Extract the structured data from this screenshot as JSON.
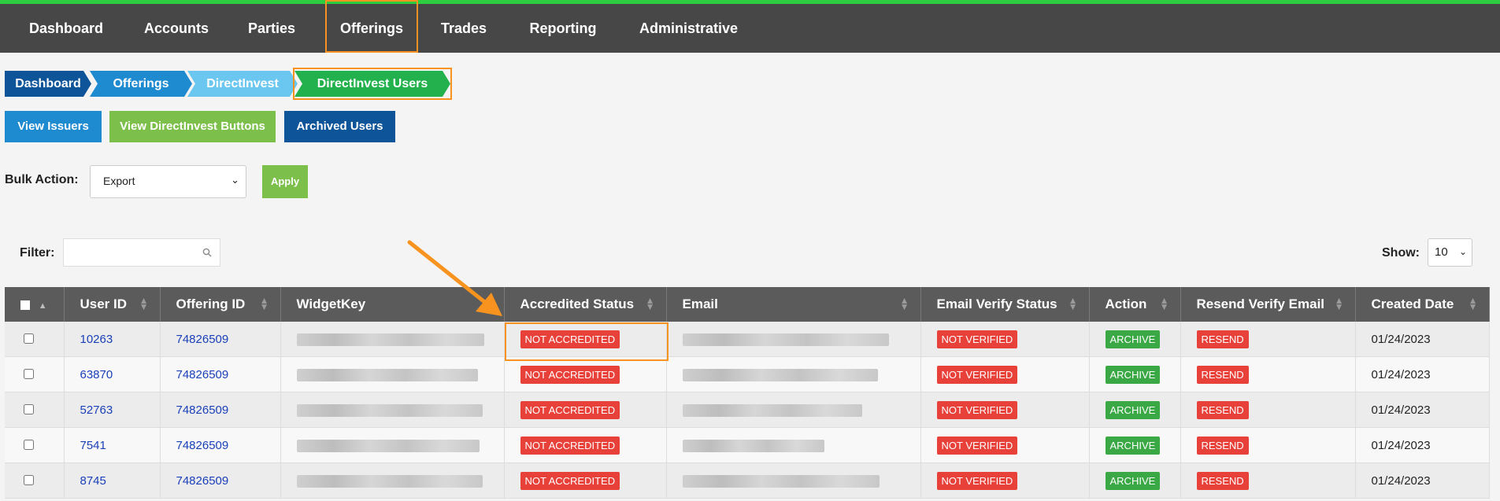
{
  "nav": {
    "items": [
      "Dashboard",
      "Accounts",
      "Parties",
      "Offerings",
      "Trades",
      "Reporting",
      "Administrative"
    ],
    "active": "Offerings"
  },
  "breadcrumb": [
    "Dashboard",
    "Offerings",
    "DirectInvest",
    "DirectInvest Users"
  ],
  "buttons": {
    "view_issuers": "View Issuers",
    "view_directinvest_buttons": "View DirectInvest Buttons",
    "archived_users": "Archived Users",
    "apply": "Apply"
  },
  "bulk_action": {
    "label": "Bulk Action:",
    "selected": "Export"
  },
  "filter": {
    "label": "Filter:",
    "value": ""
  },
  "show": {
    "label": "Show:",
    "selected": "10"
  },
  "table": {
    "columns": [
      "User ID",
      "Offering ID",
      "WidgetKey",
      "Accredited Status",
      "Email",
      "Email Verify Status",
      "Action",
      "Resend Verify Email",
      "Created Date"
    ],
    "rows": [
      {
        "user_id": "10263",
        "offering_id": "74826509",
        "accredited": "NOT ACCREDITED",
        "verify": "NOT VERIFIED",
        "action": "ARCHIVE",
        "resend": "RESEND",
        "created": "01/24/2023"
      },
      {
        "user_id": "63870",
        "offering_id": "74826509",
        "accredited": "NOT ACCREDITED",
        "verify": "NOT VERIFIED",
        "action": "ARCHIVE",
        "resend": "RESEND",
        "created": "01/24/2023"
      },
      {
        "user_id": "52763",
        "offering_id": "74826509",
        "accredited": "NOT ACCREDITED",
        "verify": "NOT VERIFIED",
        "action": "ARCHIVE",
        "resend": "RESEND",
        "created": "01/24/2023"
      },
      {
        "user_id": "7541",
        "offering_id": "74826509",
        "accredited": "NOT ACCREDITED",
        "verify": "NOT VERIFIED",
        "action": "ARCHIVE",
        "resend": "RESEND",
        "created": "01/24/2023"
      },
      {
        "user_id": "8745",
        "offering_id": "74826509",
        "accredited": "NOT ACCREDITED",
        "verify": "NOT VERIFIED",
        "action": "ARCHIVE",
        "resend": "RESEND",
        "created": "01/24/2023"
      }
    ]
  },
  "colors": {
    "nav_bg": "#474747",
    "highlight": "#f7931e",
    "badge_red": "#e8413a",
    "badge_green": "#3aa844",
    "link": "#1a3fb8"
  }
}
